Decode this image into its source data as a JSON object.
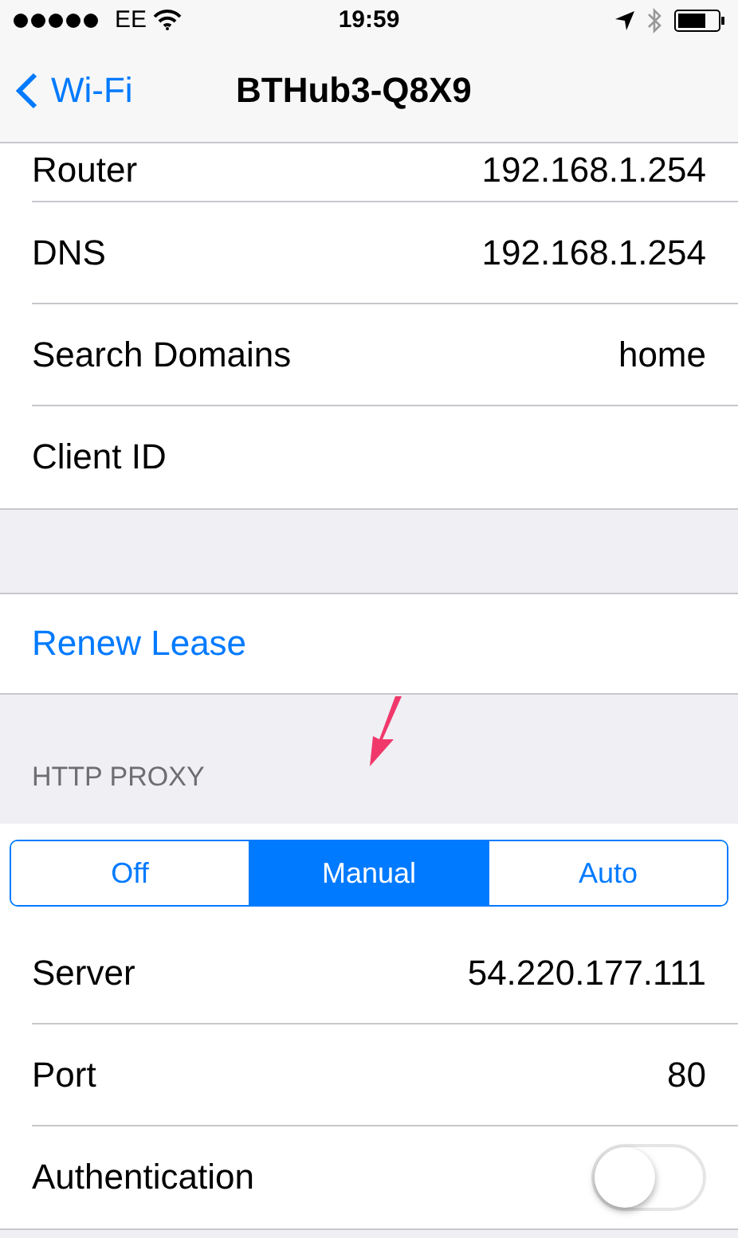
{
  "status_bar": {
    "carrier": "EE",
    "time": "19:59"
  },
  "nav": {
    "back": "Wi-Fi",
    "title": "BTHub3-Q8X9"
  },
  "ip_rows": [
    {
      "label": "Router",
      "value": "192.168.1.254"
    },
    {
      "label": "DNS",
      "value": "192.168.1.254"
    },
    {
      "label": "Search Domains",
      "value": "home"
    },
    {
      "label": "Client ID"
    }
  ],
  "renew": "Renew Lease",
  "proxy": {
    "header": "HTTP PROXY",
    "segments": [
      {
        "label": "Off",
        "selected": false
      },
      {
        "label": "Manual",
        "selected": true
      },
      {
        "label": "Auto",
        "selected": false
      }
    ],
    "rows": [
      {
        "kind": "value",
        "label": "Server",
        "value": "54.220.177.111"
      },
      {
        "kind": "value",
        "label": "Port",
        "value": "80"
      },
      {
        "kind": "toggle",
        "label": "Authentication",
        "on": false
      }
    ]
  }
}
